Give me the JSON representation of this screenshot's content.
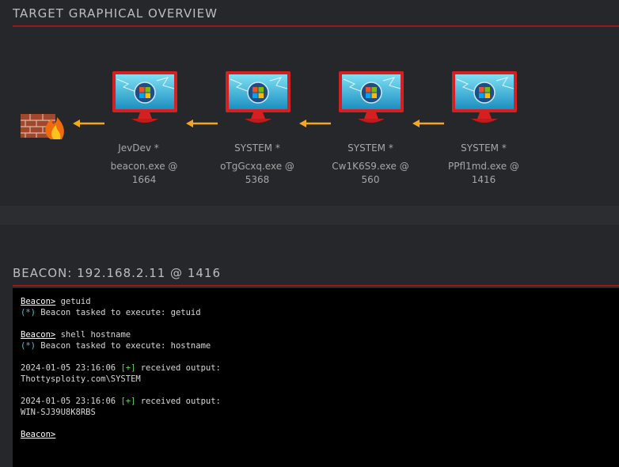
{
  "graph": {
    "title": "TARGET GRAPHICAL OVERVIEW",
    "nodes": [
      {
        "user": "JevDev *",
        "process": "beacon.exe @",
        "pid": "1664"
      },
      {
        "user": "SYSTEM *",
        "process": "oTgGcxq.exe @",
        "pid": "5368"
      },
      {
        "user": "SYSTEM *",
        "process": "Cw1K6S9.exe @",
        "pid": "560"
      },
      {
        "user": "SYSTEM *",
        "process": "PPfl1md.exe @",
        "pid": "1416"
      }
    ],
    "firewall_icon": "firewall-icon"
  },
  "beacon": {
    "title": "BEACON: 192.168.2.11 @ 1416",
    "console": {
      "prompt": "Beacon>",
      "cmd1": " getuid",
      "task1_tag": "(*)",
      "task1_text": " Beacon tasked to execute: getuid",
      "cmd2": " shell hostname",
      "task2_tag": "(*)",
      "task2_text": " Beacon tasked to execute: hostname",
      "out1_time": "2024-01-05 23:16:06 ",
      "out1_tag": "[+]",
      "out1_text": " received output:",
      "out1_value": "Thottysploity.com\\SYSTEM",
      "out2_time": "2024-01-05 23:16:06 ",
      "out2_tag": "[+]",
      "out2_text": " received output:",
      "out2_value": "WIN-SJ39U8K8RBS",
      "final_prompt": "Beacon>"
    }
  },
  "colors": {
    "accent_red": "#8e1a22",
    "arrow_orange": "#f5a623",
    "cyan": "#4fc3d8",
    "green": "#6bd16b"
  }
}
